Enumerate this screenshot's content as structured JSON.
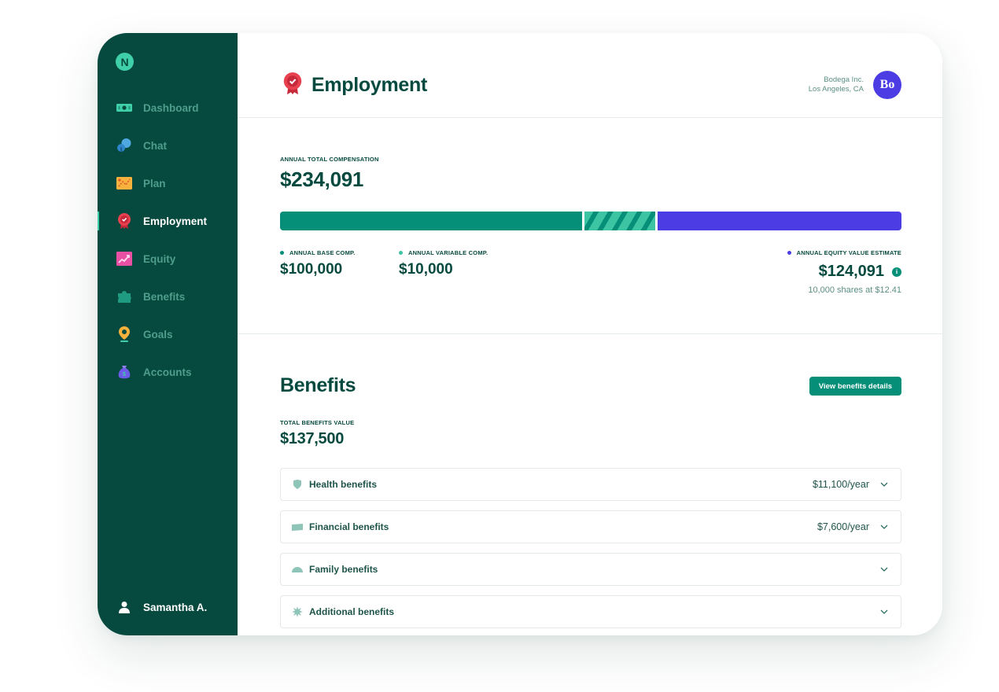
{
  "app": {
    "logo_letter": "N"
  },
  "sidebar": {
    "items": [
      {
        "label": "Dashboard",
        "icon": "cash-icon"
      },
      {
        "label": "Chat",
        "icon": "chat-bubbles-icon"
      },
      {
        "label": "Plan",
        "icon": "map-icon"
      },
      {
        "label": "Employment",
        "icon": "award-badge-icon",
        "active": true
      },
      {
        "label": "Equity",
        "icon": "growth-chart-icon"
      },
      {
        "label": "Benefits",
        "icon": "puzzle-icon"
      },
      {
        "label": "Goals",
        "icon": "location-pin-icon"
      },
      {
        "label": "Accounts",
        "icon": "money-bag-icon"
      }
    ],
    "user": {
      "name": "Samantha A.",
      "icon": "user-icon"
    }
  },
  "header": {
    "title": "Employment",
    "company_name": "Bodega Inc.",
    "company_location": "Los Angeles, CA",
    "avatar_text": "Bo"
  },
  "compensation": {
    "label": "ANNUAL TOTAL COMPENSATION",
    "total": "$234,091",
    "base": {
      "label": "ANNUAL BASE COMP.",
      "value": "$100,000",
      "amount": 100000
    },
    "variable": {
      "label": "ANNUAL VARIABLE COMP.",
      "value": "$10,000",
      "amount": 10000
    },
    "equity": {
      "label": "ANNUAL EQUITY VALUE ESTIMATE",
      "value": "$124,091",
      "amount": 124091,
      "detail": "10,000 shares at $12.41"
    }
  },
  "benefits": {
    "title": "Benefits",
    "button_label": "View benefits details",
    "total_label": "TOTAL BENEFITS VALUE",
    "total_value": "$137,500",
    "categories": [
      {
        "label": "Health benefits",
        "value": "$11,100/year",
        "icon": "shield-icon"
      },
      {
        "label": "Financial benefits",
        "value": "$7,600/year",
        "icon": "cash-icon"
      },
      {
        "label": "Family benefits",
        "value": "",
        "icon": "umbrella-icon"
      },
      {
        "label": "Additional benefits",
        "value": "",
        "icon": "sparkle-icon"
      }
    ]
  },
  "colors": {
    "sidebar_bg": "#064a3f",
    "primary": "#058e78",
    "accent_light": "#3cc4a3",
    "equity": "#4b3de3",
    "text": "#064a3f"
  }
}
